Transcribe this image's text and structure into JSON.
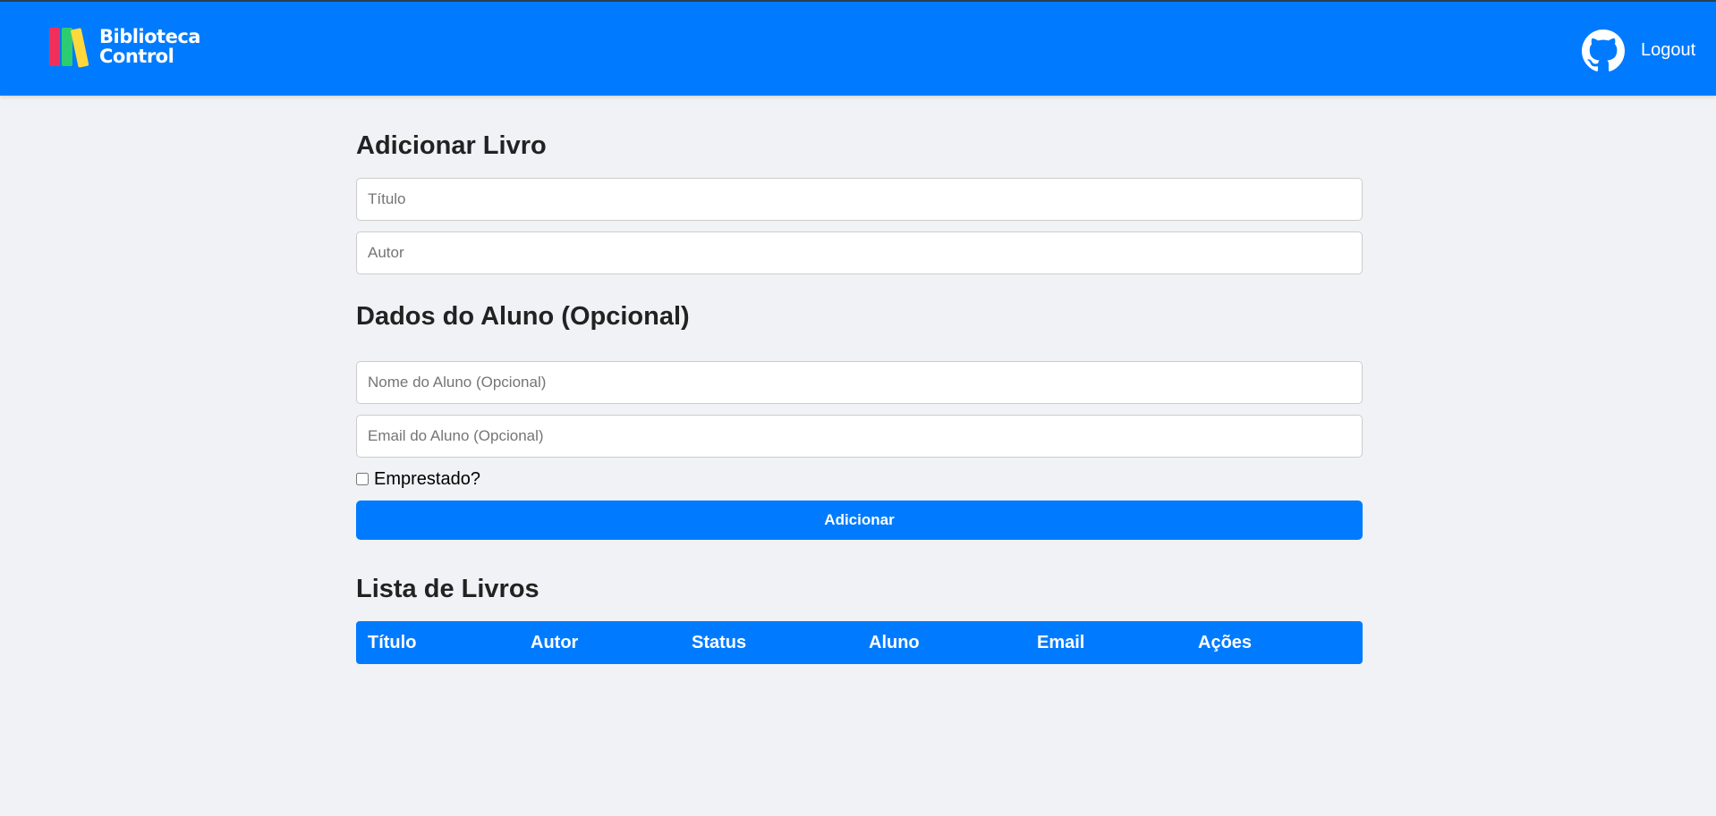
{
  "header": {
    "brand_line1": "Biblioteca",
    "brand_line2": "Control",
    "logout_label": "Logout",
    "icons": [
      "logo-icon",
      "github-icon"
    ],
    "color": "#007bff"
  },
  "add_book": {
    "title": "Adicionar Livro",
    "title_placeholder": "Título",
    "author_placeholder": "Autor"
  },
  "student": {
    "title": "Dados do Aluno (Opcional)",
    "name_placeholder": "Nome do Aluno (Opcional)",
    "email_placeholder": "Email do Aluno (Opcional)",
    "loaned_label": "Emprestado?",
    "loaned_checked": false
  },
  "add_button_label": "Adicionar",
  "list": {
    "title": "Lista de Livros",
    "columns": [
      "Título",
      "Autor",
      "Status",
      "Aluno",
      "Email",
      "Ações"
    ]
  }
}
